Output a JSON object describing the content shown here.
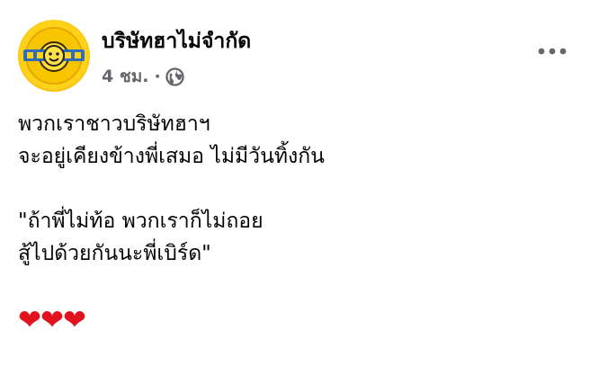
{
  "post": {
    "page_name": "บริษัทฮาไม่จำกัด",
    "timestamp": "4 ชม.",
    "separator": "·",
    "audience_icon": "globe-icon",
    "more_icon": "more-options-icon",
    "lines": [
      "พวกเราชาวบริษัทฮาฯ",
      "จะอยู่เคียงข้างพี่เสมอ ไม่มีวันทิ้งกัน",
      "",
      "\"ถ้าพี่ไม่ท้อ พวกเราก็ไม่ถอย",
      "สู้ไปด้วยกันนะพี่เบิร์ด\""
    ],
    "hearts": "❤❤❤"
  },
  "colors": {
    "text": "#050505",
    "secondary_text": "#65676b",
    "heart": "#e0131e",
    "avatar_yellow": "#ffd21a"
  }
}
